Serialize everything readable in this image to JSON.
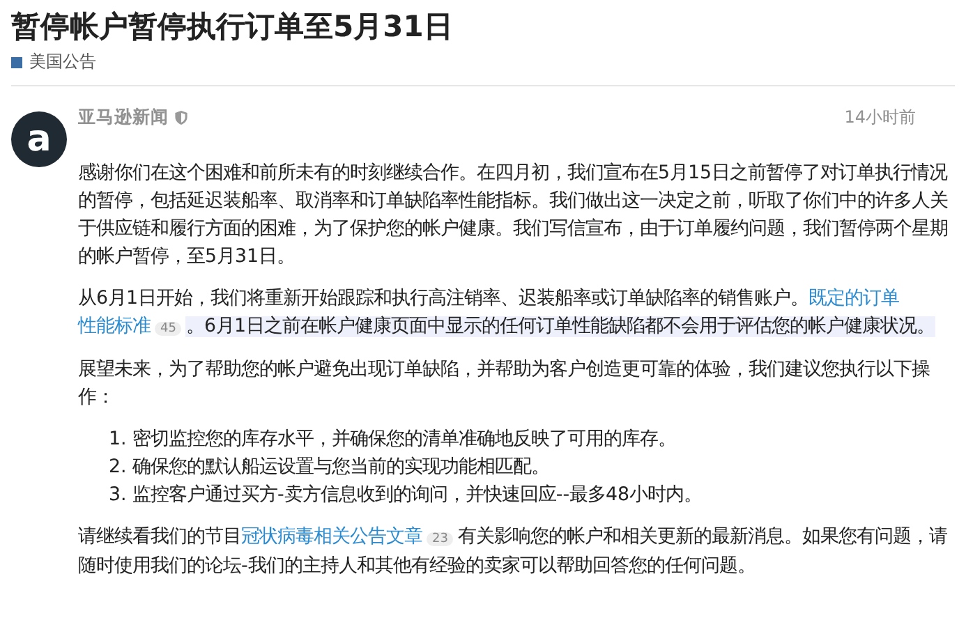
{
  "title": "暂停帐户暂停执行订单至5月31日",
  "category": {
    "label": "美国公告",
    "color": "#3a6ea5"
  },
  "post": {
    "author": "亚马逊新闻",
    "avatar_letter": "a",
    "time": "14小时前",
    "paragraphs": [
      {
        "kind": "text",
        "text": "感谢你们在这个困难和前所未有的时刻继续合作。在四月初，我们宣布在5月15日之前暂停了对订单执行情况的暂停，包括延迟装船率、取消率和订单缺陷率性能指标。我们做出这一决定之前，听取了你们中的许多人关于供应链和履行方面的困难，为了保护您的帐户健康。我们写信宣布，由于订单履约问题，我们暂停两个星期的帐户暂停，至5月31日。"
      },
      {
        "kind": "linked",
        "before": "从6月1日开始，我们将重新开始跟踪和执行高注销率、迟装船率或订单缺陷率的销售账户。",
        "link": [
          "既定的订单",
          "性能标准"
        ],
        "count": "45",
        "highlight": "。6月1日之前在帐户健康页面中显示的任何订单性能缺陷都不会用于评估您的帐户健康状况。"
      },
      {
        "kind": "text",
        "text": "展望未来，为了帮助您的帐户避免出现订单缺陷，并帮助为客户创造更可靠的体验，我们建议您执行以下操作："
      },
      {
        "kind": "list",
        "items": [
          "1. 密切监控您的库存水平，并确保您的清单准确地反映了可用的库存。",
          "2. 确保您的默认船运设置与您当前的实现功能相匹配。",
          "3. 监控客户通过买方-卖方信息收到的询问，并快速回应--最多48小时内。"
        ]
      },
      {
        "kind": "linked",
        "before": "请继续看我们的节目",
        "link": [
          "冠状病毒相关公告文章"
        ],
        "count": "23",
        "after": "有关影响您的帐户和相关更新的最新消息。如果您有问题，请随时使用我们的论坛-我们的主持人和其他有经验的卖家可以帮助回答您的任何问题。"
      }
    ]
  }
}
